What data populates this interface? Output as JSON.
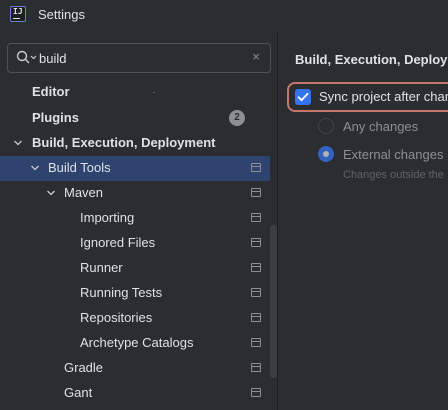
{
  "window": {
    "title": "Settings",
    "logo_text": "IJ"
  },
  "search": {
    "value": "build",
    "clear_glyph": "×"
  },
  "tree": {
    "editor": "Editor",
    "plugins": "Plugins",
    "plugins_badge": "2",
    "build_exec_deploy": "Build, Execution, Deployment",
    "build_tools": "Build Tools",
    "maven": "Maven",
    "importing": "Importing",
    "ignored_files": "Ignored Files",
    "runner": "Runner",
    "running_tests": "Running Tests",
    "repositories": "Repositories",
    "archetype_catalogs": "Archetype Catalogs",
    "gradle": "Gradle",
    "gant": "Gant"
  },
  "right": {
    "breadcrumb": "Build, Execution, Deployme",
    "sync_label": "Sync project after chang",
    "sync_checked": true,
    "any_changes": "Any changes",
    "external_changes": "External changes",
    "external_hint": "Changes outside the"
  },
  "colors": {
    "accent": "#3574f0",
    "selection": "#2e436e",
    "focus_ring": "#c4776a",
    "background": "#2b2d30"
  }
}
